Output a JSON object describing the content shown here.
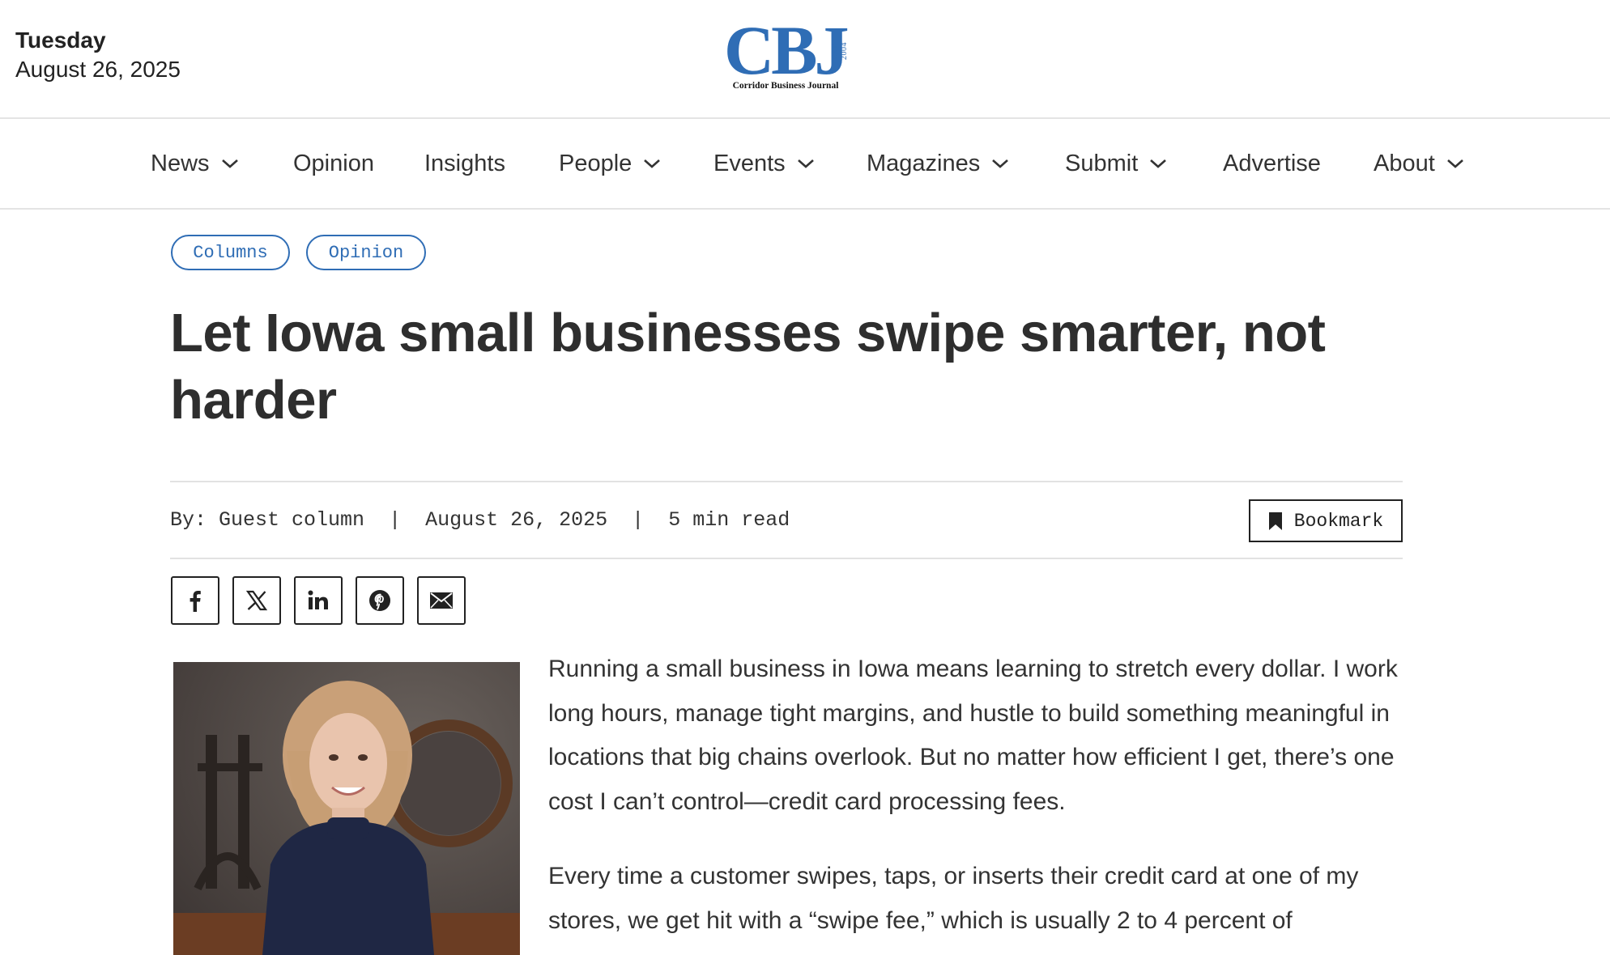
{
  "header": {
    "day": "Tuesday",
    "date": "August 26, 2025",
    "logo_letters": "CBJ",
    "logo_est": "EST. 2004",
    "logo_subtitle": "Corridor Business Journal"
  },
  "nav": {
    "items": [
      {
        "label": "News",
        "dropdown": true
      },
      {
        "label": "Opinion",
        "dropdown": false
      },
      {
        "label": "Insights",
        "dropdown": false
      },
      {
        "label": "People",
        "dropdown": true
      },
      {
        "label": "Events",
        "dropdown": true
      },
      {
        "label": "Magazines",
        "dropdown": true
      },
      {
        "label": "Submit",
        "dropdown": true
      },
      {
        "label": "Advertise",
        "dropdown": false
      },
      {
        "label": "About",
        "dropdown": true
      }
    ]
  },
  "article": {
    "tags": [
      "Columns",
      "Opinion"
    ],
    "headline": "Let Iowa small businesses swipe smarter, not harder",
    "byline": "By: Guest column",
    "separator": "|",
    "date": "August 26, 2025",
    "read_time": "5 min read",
    "bookmark_label": "Bookmark",
    "share_icons": [
      "facebook-icon",
      "x-icon",
      "linkedin-icon",
      "pinterest-icon",
      "email-icon"
    ],
    "paragraphs": [
      "Running a small business in Iowa means learning to stretch every dollar. I work long hours, manage tight margins, and hustle to build something meaningful in locations that big chains overlook. But no matter how efficient I get, there’s one cost I can’t control—credit card processing fees.",
      "Every time a customer swipes, taps, or inserts their credit card at one of my stores, we get hit with a “swipe fee,” which is usually 2 to 4 percent of"
    ]
  },
  "colors": {
    "brand_blue": "#2f6db5",
    "text": "#2b2b2b"
  }
}
